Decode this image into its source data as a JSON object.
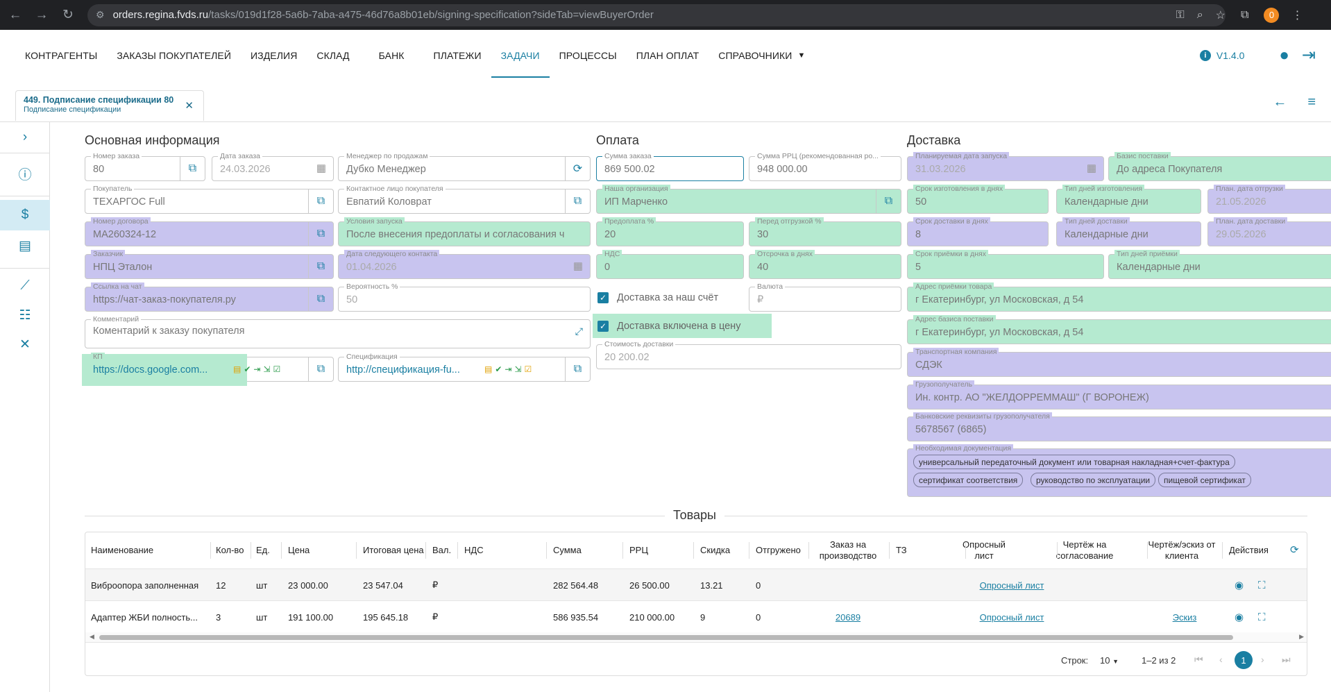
{
  "browser": {
    "url_host": "orders.regina.fvds.ru",
    "url_path": "/tasks/019d1f28-5a6b-7aba-a475-46d76a8b01eb/signing-specification?sideTab=viewBuyerOrder",
    "profile_initial": "0"
  },
  "menu": {
    "items": [
      "КОНТРАГЕНТЫ",
      "ЗАКАЗЫ ПОКУПАТЕЛЕЙ",
      "ИЗДЕЛИЯ",
      "СКЛАД",
      "БАНК",
      "ПЛАТЕЖИ",
      "ЗАДАЧИ",
      "ПРОЦЕССЫ",
      "ПЛАН ОПЛАТ",
      "СПРАВОЧНИКИ"
    ],
    "active": "ЗАДАЧИ",
    "version": "V1.4.0"
  },
  "tab": {
    "title": "449. Подписание спецификации 80",
    "subtitle": "Подписание спецификации"
  },
  "main": {
    "title": "Основная информация",
    "order_number": {
      "label": "Номер заказа",
      "value": "80"
    },
    "order_date": {
      "label": "Дата заказа",
      "value": "24.03.2026"
    },
    "manager": {
      "label": "Менеджер по продажам",
      "value": "Дубко Менеджер"
    },
    "buyer": {
      "label": "Покупатель",
      "value": "ТЕХАРГОС Full"
    },
    "contact": {
      "label": "Контактное лицо покупателя",
      "value": "Евпатий Коловрат"
    },
    "contract": {
      "label": "Номер договора",
      "value": "МА260324-12"
    },
    "launch_terms": {
      "label": "Условия запуска",
      "value": "После внесения предоплаты и согласования ч"
    },
    "customer": {
      "label": "Заказчик",
      "value": "НПЦ Эталон"
    },
    "next_contact": {
      "label": "Дата следующего контакта",
      "value": "01.04.2026"
    },
    "chat_link": {
      "label": "Ссылка на чат",
      "value": "https://чат-заказ-покупателя.ру"
    },
    "probability": {
      "label": "Вероятность %",
      "value": "50"
    },
    "comment": {
      "label": "Комментарий",
      "value": "Коментарий к заказу покупателя"
    },
    "kp": {
      "label": "КП",
      "value": "https://docs.google.com..."
    },
    "spec": {
      "label": "Спецификация",
      "value": "http://спецификация-fu..."
    }
  },
  "payment": {
    "title": "Оплата",
    "order_sum": {
      "label": "Сумма заказа",
      "value": "869 500.02"
    },
    "rrp_sum": {
      "label": "Сумма РРЦ (рекомендованная ро...",
      "value": "948 000.00"
    },
    "our_org": {
      "label": "Наша организация",
      "value": "ИП Марченко"
    },
    "prepay": {
      "label": "Предоплата %",
      "value": "20"
    },
    "before_ship": {
      "label": "Перед отгрузкой %",
      "value": "30"
    },
    "vat": {
      "label": "НДС",
      "value": "0"
    },
    "delay": {
      "label": "Отсрочка в днях",
      "value": "40"
    },
    "delivery_our_cost": "Доставка за наш счёт",
    "currency": {
      "label": "Валюта",
      "value": "₽"
    },
    "delivery_included": "Доставка включена в цену",
    "delivery_cost": {
      "label": "Стоимость доставки",
      "value": "20 200.02"
    }
  },
  "delivery": {
    "title": "Доставка",
    "plan_launch": {
      "label": "Планируемая дата запуска",
      "value": "31.03.2026"
    },
    "basis": {
      "label": "Базис поставки",
      "value": "До адреса Покупателя"
    },
    "make_days": {
      "label": "Срок изготовления в днях",
      "value": "50"
    },
    "make_type": {
      "label": "Тип дней изготовления",
      "value": "Календарные дни"
    },
    "plan_ship": {
      "label": "План. дата отгрузки",
      "value": "21.05.2026"
    },
    "del_days": {
      "label": "Срок доставки в днях",
      "value": "8"
    },
    "del_type": {
      "label": "Тип дней доставки",
      "value": "Календарные дни"
    },
    "plan_del": {
      "label": "План. дата доставки",
      "value": "29.05.2026"
    },
    "accept_days": {
      "label": "Срок приёмки в днях",
      "value": "5"
    },
    "accept_type": {
      "label": "Тип дней приёмки",
      "value": "Календарные дни"
    },
    "accept_addr": {
      "label": "Адрес приёмки товара",
      "value": "г Екатеринбург, ул Московская, д 54"
    },
    "basis_addr": {
      "label": "Адрес базиса поставки",
      "value": "г Екатеринбург, ул Московская, д 54"
    },
    "transport": {
      "label": "Транспортная компания",
      "value": "СДЭК"
    },
    "consignee": {
      "label": "Грузополучатель",
      "value": "Ин. контр. АО \"ЖЕЛДОРРЕММАШ\" (Г ВОРОНЕЖ)"
    },
    "bank": {
      "label": "Банковские реквизиты грузополучателя",
      "value": "5678567 (6865)"
    },
    "docs": {
      "label": "Необходимая документация",
      "items": [
        "универсальный передаточный документ или товарная накладная+счет-фактура",
        "сертификат соответствия",
        "руководство по эксплуатации",
        "пищевой сертификат"
      ]
    }
  },
  "goods": {
    "title": "Товары",
    "columns": [
      "Наименование",
      "Кол-во",
      "Ед.",
      "Цена",
      "Итоговая цена",
      "Вал.",
      "НДС",
      "Сумма",
      "РРЦ",
      "Скидка",
      "Отгружено",
      "Заказ на производство",
      "ТЗ",
      "Опросный лист",
      "Чертёж на согласование",
      "Чертёж/эскиз от клиента",
      "Действия"
    ],
    "rows": [
      {
        "name": "Виброопора заполненная",
        "qty": "12",
        "unit": "шт",
        "price": "23 000.00",
        "total_price": "23 547.04",
        "cur": "₽",
        "vat": "",
        "sum": "282 564.48",
        "rrp": "26 500.00",
        "discount": "13.21",
        "shipped": "0",
        "prod_order": "",
        "tz": "",
        "survey": "Опросный лист",
        "draw_appr": "",
        "draw_client": ""
      },
      {
        "name": "Адаптер ЖБИ полность...",
        "qty": "3",
        "unit": "шт",
        "price": "191 100.00",
        "total_price": "195 645.18",
        "cur": "₽",
        "vat": "",
        "sum": "586 935.54",
        "rrp": "210 000.00",
        "discount": "9",
        "shipped": "0",
        "prod_order": "20689",
        "tz": "",
        "survey": "Опросный лист",
        "draw_appr": "",
        "draw_client": "Эскиз"
      }
    ],
    "pager": {
      "rows_label": "Строк:",
      "rows_value": "10",
      "range": "1–2 из 2",
      "page": "1"
    }
  }
}
